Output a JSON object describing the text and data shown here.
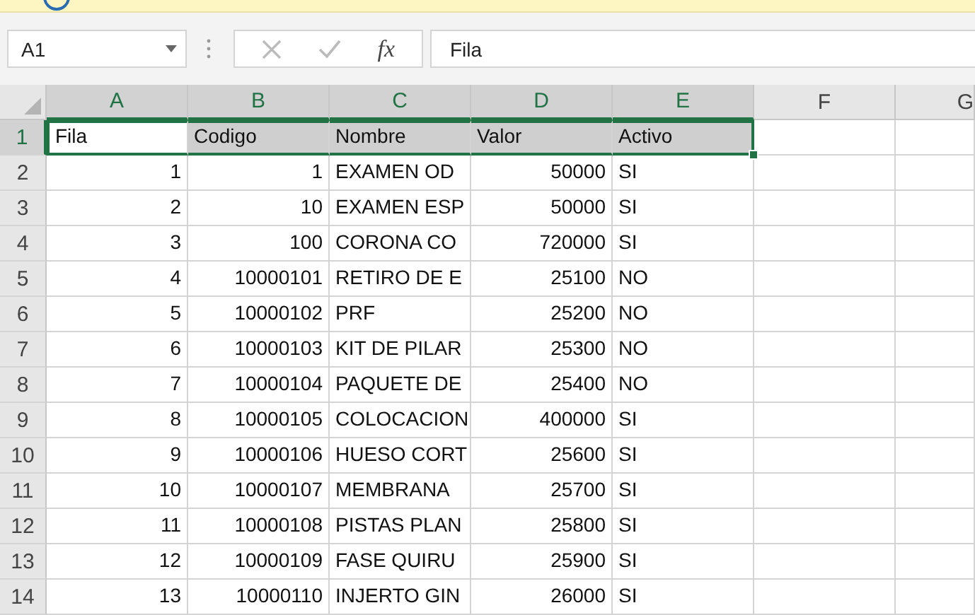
{
  "formula_bar": {
    "name_box": "A1",
    "function_label": "fx",
    "formula": "Fila"
  },
  "sheet": {
    "columns": [
      {
        "label": "A",
        "selected": true,
        "kind": "number"
      },
      {
        "label": "B",
        "selected": true,
        "kind": "number"
      },
      {
        "label": "C",
        "selected": true,
        "kind": "text"
      },
      {
        "label": "D",
        "selected": true,
        "kind": "number"
      },
      {
        "label": "E",
        "selected": true,
        "kind": "text"
      },
      {
        "label": "F",
        "selected": false
      },
      {
        "label": "G",
        "selected": false
      }
    ],
    "rows": [
      {
        "label": "1",
        "selected": true,
        "cells": [
          "Fila",
          "Codigo",
          "Nombre",
          "Valor",
          "Activo"
        ]
      },
      {
        "label": "2",
        "selected": false,
        "cells": [
          "1",
          "1",
          "EXAMEN OD",
          "50000",
          "SI"
        ]
      },
      {
        "label": "3",
        "selected": false,
        "cells": [
          "2",
          "10",
          "EXAMEN ESP",
          "50000",
          "SI"
        ]
      },
      {
        "label": "4",
        "selected": false,
        "cells": [
          "3",
          "100",
          "CORONA CO",
          "720000",
          "SI"
        ]
      },
      {
        "label": "5",
        "selected": false,
        "cells": [
          "4",
          "10000101",
          "RETIRO DE E",
          "25100",
          "NO"
        ]
      },
      {
        "label": "6",
        "selected": false,
        "cells": [
          "5",
          "10000102",
          "PRF",
          "25200",
          "NO"
        ]
      },
      {
        "label": "7",
        "selected": false,
        "cells": [
          "6",
          "10000103",
          "KIT DE PILAR",
          "25300",
          "NO"
        ]
      },
      {
        "label": "8",
        "selected": false,
        "cells": [
          "7",
          "10000104",
          "PAQUETE DE",
          "25400",
          "NO"
        ]
      },
      {
        "label": "9",
        "selected": false,
        "cells": [
          "8",
          "10000105",
          "COLOCACION",
          "400000",
          "SI"
        ]
      },
      {
        "label": "10",
        "selected": false,
        "cells": [
          "9",
          "10000106",
          "HUESO CORT",
          "25600",
          "SI"
        ]
      },
      {
        "label": "11",
        "selected": false,
        "cells": [
          "10",
          "10000107",
          "MEMBRANA",
          "25700",
          "SI"
        ]
      },
      {
        "label": "12",
        "selected": false,
        "cells": [
          "11",
          "10000108",
          "PISTAS PLAN",
          "25800",
          "SI"
        ]
      },
      {
        "label": "13",
        "selected": false,
        "cells": [
          "12",
          "10000109",
          "FASE QUIRU",
          "25900",
          "SI"
        ]
      },
      {
        "label": "14",
        "selected": false,
        "cells": [
          "13",
          "10000110",
          "INJERTO GIN",
          "26000",
          "SI"
        ]
      }
    ]
  }
}
